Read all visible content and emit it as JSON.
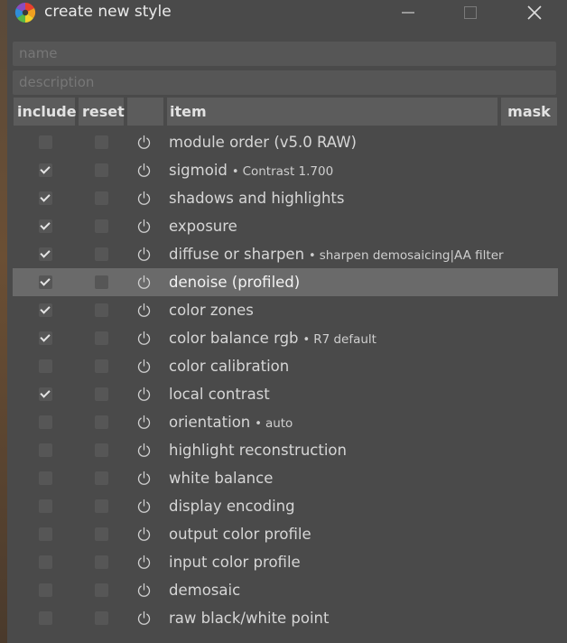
{
  "window": {
    "title": "create new style"
  },
  "fields": {
    "name_placeholder": "name",
    "description_placeholder": "description"
  },
  "columns": {
    "include": "include",
    "reset": "reset",
    "item": "item",
    "mask": "mask"
  },
  "rows": [
    {
      "name": "module order (v5.0 RAW)",
      "sub": "",
      "include": false,
      "reset": false,
      "selected": false
    },
    {
      "name": "sigmoid",
      "sub": "Contrast 1.700",
      "include": true,
      "reset": false,
      "selected": false
    },
    {
      "name": "shadows and highlights",
      "sub": "",
      "include": true,
      "reset": false,
      "selected": false
    },
    {
      "name": "exposure",
      "sub": "",
      "include": true,
      "reset": false,
      "selected": false
    },
    {
      "name": "diffuse or sharpen",
      "sub": "sharpen demosaicing|AA filter",
      "include": true,
      "reset": false,
      "selected": false
    },
    {
      "name": "denoise (profiled)",
      "sub": "",
      "include": true,
      "reset": false,
      "selected": true
    },
    {
      "name": "color zones",
      "sub": "",
      "include": true,
      "reset": false,
      "selected": false
    },
    {
      "name": "color balance rgb",
      "sub": "R7 default",
      "include": true,
      "reset": false,
      "selected": false
    },
    {
      "name": "color calibration",
      "sub": "",
      "include": false,
      "reset": false,
      "selected": false
    },
    {
      "name": "local contrast",
      "sub": "",
      "include": true,
      "reset": false,
      "selected": false
    },
    {
      "name": "orientation",
      "sub": "auto",
      "include": false,
      "reset": false,
      "selected": false
    },
    {
      "name": "highlight reconstruction",
      "sub": "",
      "include": false,
      "reset": false,
      "selected": false
    },
    {
      "name": "white balance",
      "sub": "",
      "include": false,
      "reset": false,
      "selected": false
    },
    {
      "name": "display encoding",
      "sub": "",
      "include": false,
      "reset": false,
      "selected": false
    },
    {
      "name": "output color profile",
      "sub": "",
      "include": false,
      "reset": false,
      "selected": false
    },
    {
      "name": "input color profile",
      "sub": "",
      "include": false,
      "reset": false,
      "selected": false
    },
    {
      "name": "demosaic",
      "sub": "",
      "include": false,
      "reset": false,
      "selected": false
    },
    {
      "name": "raw black/white point",
      "sub": "",
      "include": false,
      "reset": false,
      "selected": false
    }
  ]
}
